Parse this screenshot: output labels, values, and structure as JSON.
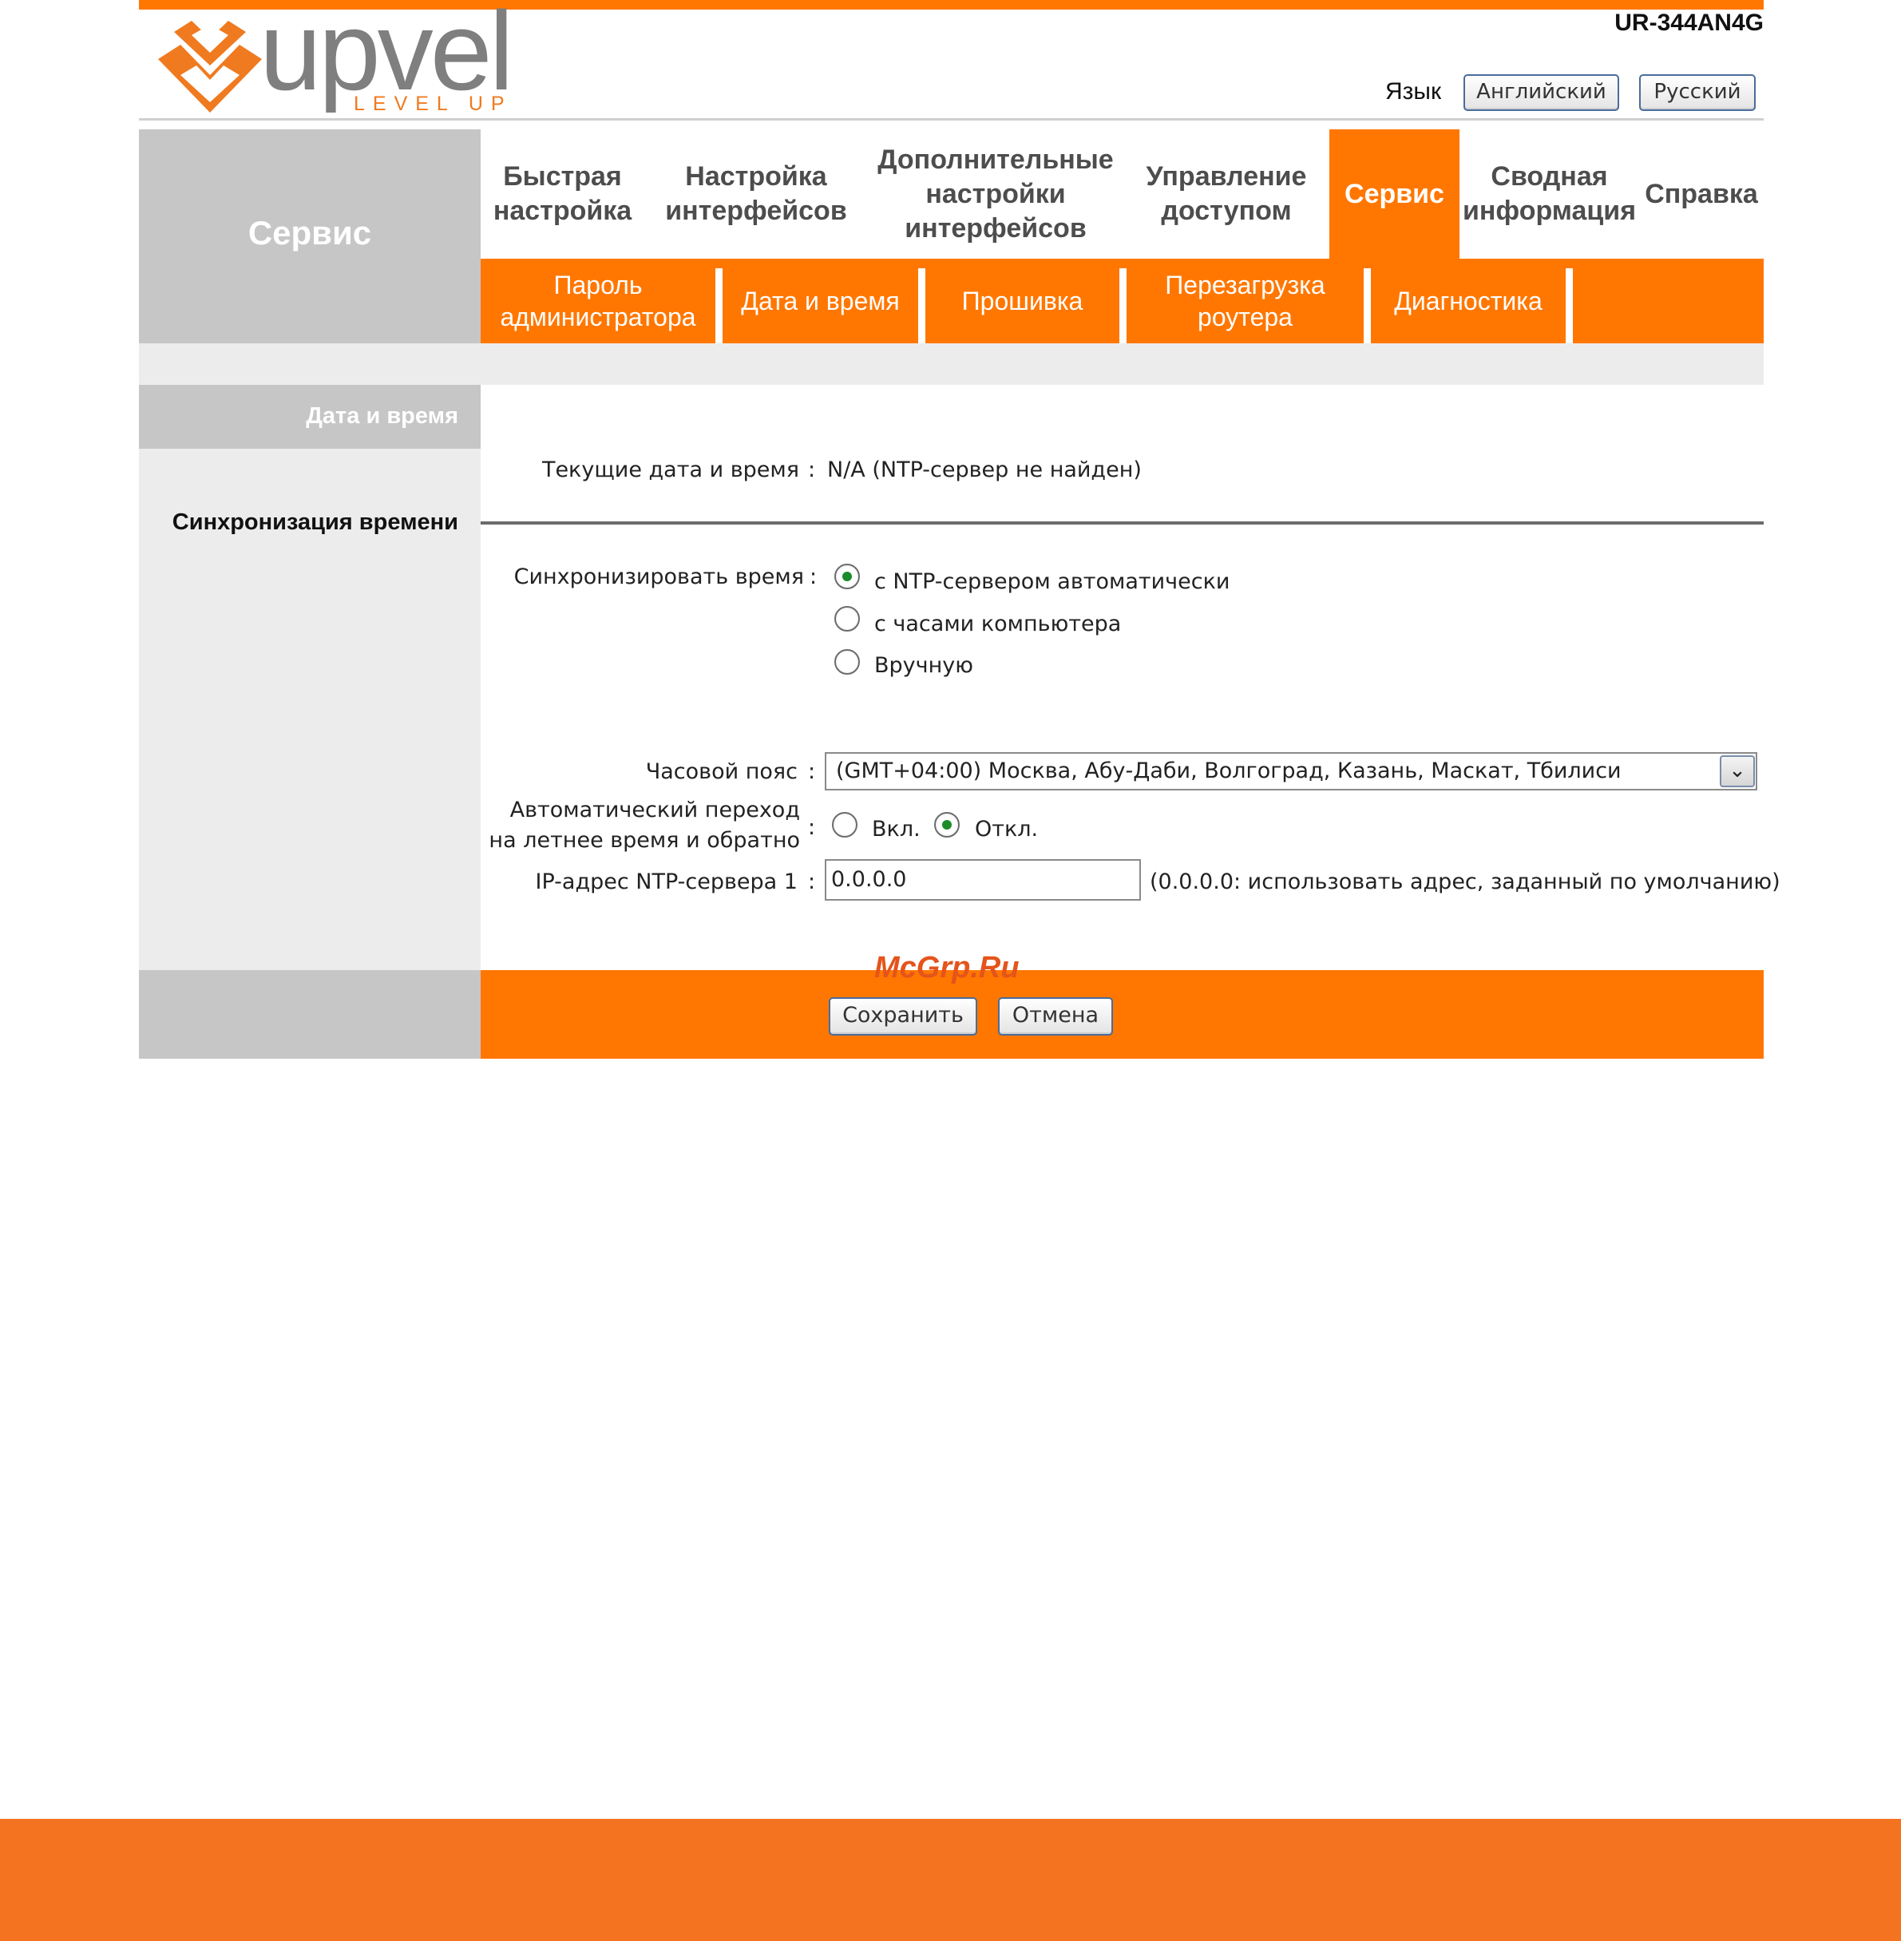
{
  "brand": {
    "logo_text": "upvel",
    "logo_sub": "LEVEL UP",
    "model": "UR-344AN4G",
    "accent_color": "#ff7700"
  },
  "language": {
    "label": "Язык",
    "english": "Английский",
    "russian": "Русский"
  },
  "section_title": "Сервис",
  "nav": [
    {
      "label": "Быстрая настройка",
      "active": false
    },
    {
      "label": "Настройка интерфейсов",
      "active": false
    },
    {
      "label": "Дополнительные настройки интерфейсов",
      "active": false
    },
    {
      "label": "Управление доступом",
      "active": false
    },
    {
      "label": "Сервис",
      "active": true
    },
    {
      "label": "Сводная информация",
      "active": false
    },
    {
      "label": "Справка",
      "active": false
    }
  ],
  "subnav": [
    {
      "label": "Пароль администратора"
    },
    {
      "label": "Дата и время"
    },
    {
      "label": "Прошивка"
    },
    {
      "label": "Перезагрузка роутера"
    },
    {
      "label": "Диагностика"
    }
  ],
  "left": {
    "section_head": "Дата и время",
    "sync_heading": "Синхронизация времени"
  },
  "current": {
    "label": "Текущие дата и время",
    "value": "N/A (NTP-сервер не найден)"
  },
  "sync": {
    "label": "Синхронизировать время",
    "options": [
      {
        "label": "с NTP-сервером автоматически",
        "selected": true
      },
      {
        "label": "с часами компьютера",
        "selected": false
      },
      {
        "label": "Вручную",
        "selected": false
      }
    ]
  },
  "timezone": {
    "label": "Часовой пояс",
    "value": "(GMT+04:00) Москва, Абу-Даби, Волгоград, Казань, Маскат, Тбилиси"
  },
  "dst": {
    "label": "Автоматический переход на летнее время и обратно",
    "on_label": "Вкл.",
    "off_label": "Откл.",
    "value": "off"
  },
  "ntp": {
    "label": "IP-адрес NTP-сервера 1",
    "value": "0.0.0.0",
    "hint": "(0.0.0.0: использовать адрес, заданный по умолчанию)"
  },
  "actions": {
    "save": "Сохранить",
    "cancel": "Отмена"
  },
  "colon": ":",
  "watermark": "McGrp.Ru"
}
